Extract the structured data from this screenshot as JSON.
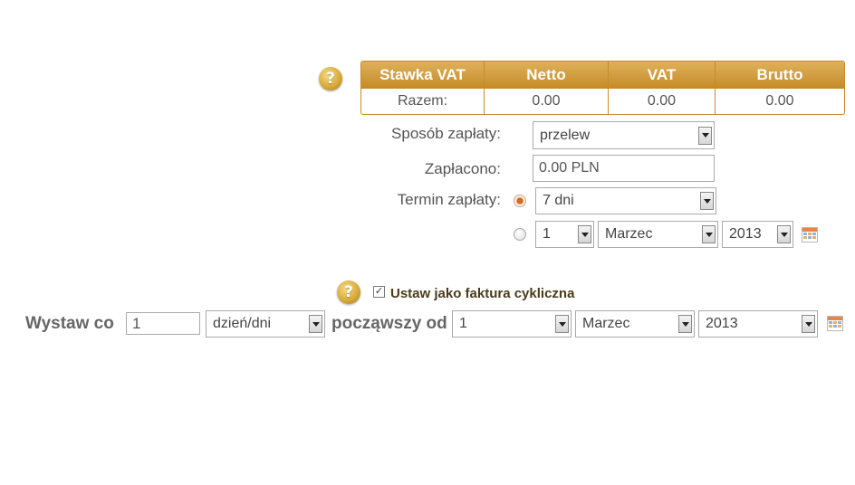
{
  "vat_table": {
    "headers": [
      "Stawka VAT",
      "Netto",
      "VAT",
      "Brutto"
    ],
    "total_row": [
      "Razem:",
      "0.00",
      "0.00",
      "0.00"
    ]
  },
  "payment": {
    "method_label": "Sposób zapłaty:",
    "method_value": "przelew",
    "paid_label": "Zapłacono:",
    "paid_value": "0.00 PLN",
    "term_label": "Termin zapłaty:",
    "term_value": "7 dni",
    "date_day": "1",
    "date_month": "Marzec",
    "date_year": "2013"
  },
  "cyclic": {
    "checkbox_label": "Ustaw jako faktura cykliczna",
    "checkbox_mark": "✓",
    "issue_every_label": "Wystaw co",
    "interval_value": "1",
    "unit_value": "dzień/dni",
    "starting_label": "począwszy od",
    "start_day": "1",
    "start_month": "Marzec",
    "start_year": "2013"
  },
  "help_glyph": "?",
  "icons": [
    "help-icon",
    "calendar-icon",
    "dropdown-arrow-icon"
  ]
}
